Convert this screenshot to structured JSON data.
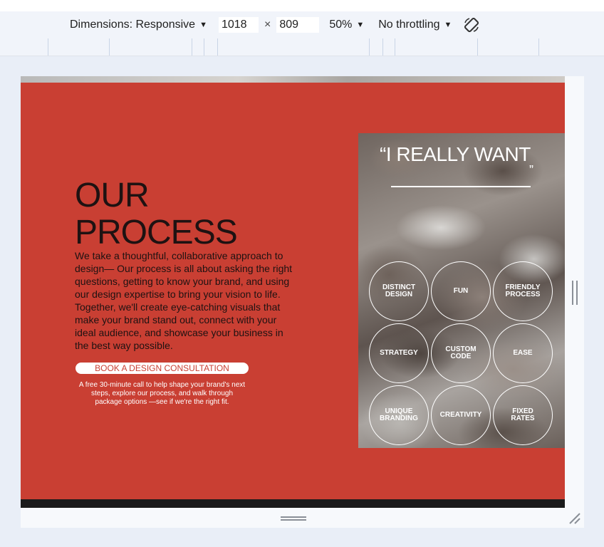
{
  "toolbar": {
    "dimensions_label": "Dimensions: Responsive",
    "width_value": "1018",
    "times_symbol": "×",
    "height_value": "809",
    "zoom_label": "50%",
    "throttling_label": "No throttling",
    "icons": {
      "dropdown": "caret-down-icon",
      "rotate": "rotate-icon"
    }
  },
  "page": {
    "heading_line1": "OUR",
    "heading_line2": "PROCESS",
    "description": "We take a thoughtful, collaborative approach to design— Our process is all about asking the right questions, getting to know your brand, and using our design expertise to bring your vision to life. Together, we'll create eye-catching visuals that make your brand stand out, connect with your ideal audience, and showcase your business in the best way possible.",
    "cta_label": "BOOK A DESIGN CONSULTATION",
    "cta_note": "A free 30-minute call to help shape your brand's next steps, explore our process, and walk through package options —see if we're the right fit.",
    "quote_title": "“I REALLY WANT",
    "quote_close": "”",
    "features": [
      "DISTINCT\nDESIGN",
      "FUN",
      "FRIENDLY\nPROCESS",
      "STRATEGY",
      "CUSTOM\nCODE",
      "EASE",
      "UNIQUE\nBRANDING",
      "CREATIVITY",
      "FIXED\nRATES"
    ]
  },
  "colors": {
    "accent_red": "#c93f33",
    "heading_dark": "#1e1212",
    "toolbar_bg": "#f1f4fa",
    "viewport_bg": "#e9eef7",
    "bottom_bar": "#1b1b1b"
  }
}
